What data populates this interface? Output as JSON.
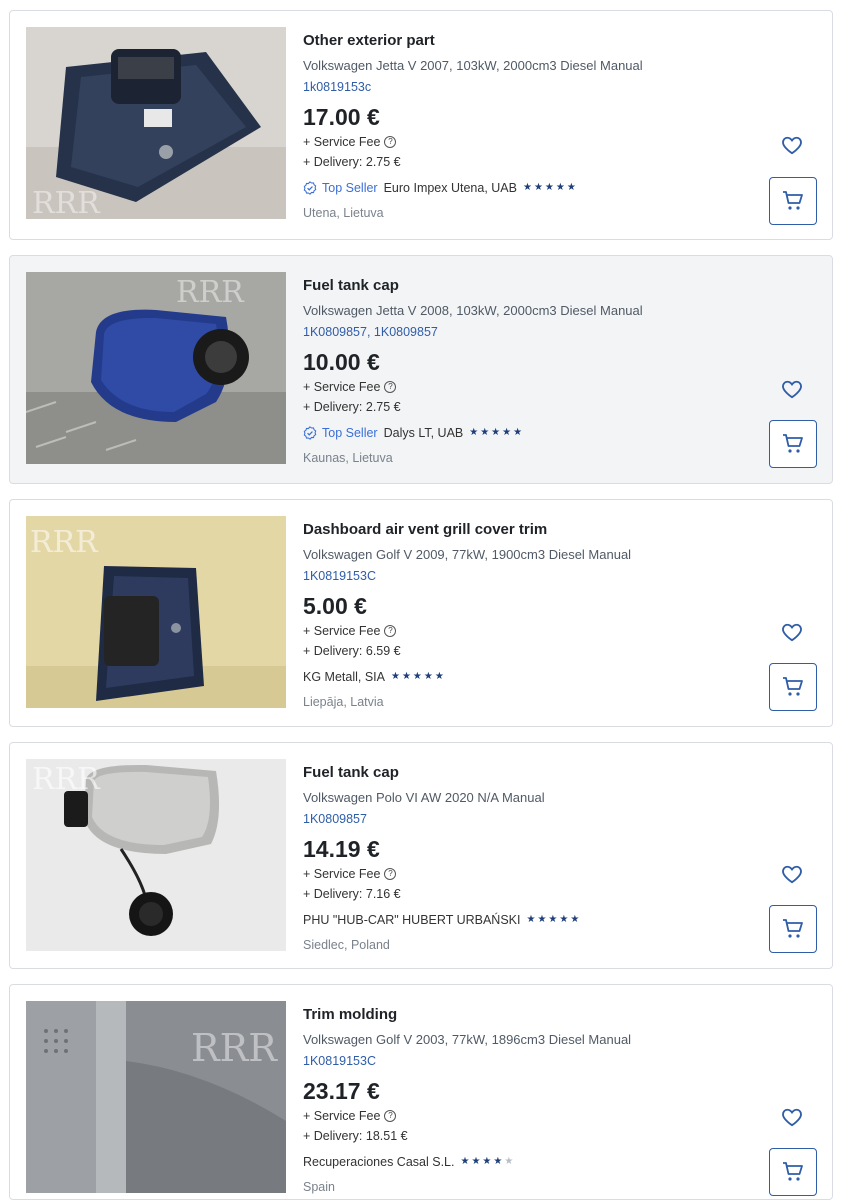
{
  "listings": [
    {
      "title": "Other exterior part",
      "vehicle": "Volkswagen Jetta V 2007, 103kW, 2000cm3 Diesel Manual",
      "codes": "1k0819153c",
      "price": "17.00 €",
      "service_fee": "+ Service Fee",
      "delivery": "+ Delivery: 2.75 €",
      "top_seller": "Top Seller",
      "seller": "Euro Impex Utena, UAB",
      "rating": 5,
      "location": "Utena, Lietuva"
    },
    {
      "title": "Fuel tank cap",
      "vehicle": "Volkswagen Jetta V 2008, 103kW, 2000cm3 Diesel Manual",
      "codes": "1K0809857, 1K0809857",
      "price": "10.00 €",
      "service_fee": "+ Service Fee",
      "delivery": "+ Delivery: 2.75 €",
      "top_seller": "Top Seller",
      "seller": "Dalys LT, UAB",
      "rating": 5,
      "location": "Kaunas, Lietuva"
    },
    {
      "title": "Dashboard air vent grill cover trim",
      "vehicle": "Volkswagen Golf V 2009, 77kW, 1900cm3 Diesel Manual",
      "codes": "1K0819153C",
      "price": "5.00 €",
      "service_fee": "+ Service Fee",
      "delivery": "+ Delivery: 6.59 €",
      "seller": "KG Metall, SIA",
      "rating": 5,
      "location": "Liepāja, Latvia"
    },
    {
      "title": "Fuel tank cap",
      "vehicle": "Volkswagen Polo VI AW 2020 N/A Manual",
      "codes": "1K0809857",
      "price": "14.19 €",
      "service_fee": "+ Service Fee",
      "delivery": "+ Delivery: 7.16 €",
      "seller": "PHU \"HUB-CAR\" HUBERT URBAŃSKI",
      "rating": 5,
      "location": "Siedlec, Poland"
    },
    {
      "title": "Trim molding",
      "vehicle": "Volkswagen Golf V 2003, 77kW, 1896cm3 Diesel Manual",
      "codes": "1K0819153C",
      "price": "23.17 €",
      "service_fee": "+ Service Fee",
      "delivery": "+ Delivery: 18.51 €",
      "seller": "Recuperaciones Casal S.L.",
      "rating": 4,
      "location": "Spain"
    }
  ],
  "icons": {
    "favorite": "heart-icon",
    "cart": "cart-icon",
    "help": "question-circle-icon",
    "top_seller": "verified-badge-icon",
    "rating": "star-icon"
  },
  "watermark": "RRR",
  "colors": {
    "link": "#2f5da8",
    "star": "#1f3f7a",
    "top_seller": "#3b6fd6",
    "border": "#d9dde3",
    "highlight_bg": "#f3f4f6"
  }
}
